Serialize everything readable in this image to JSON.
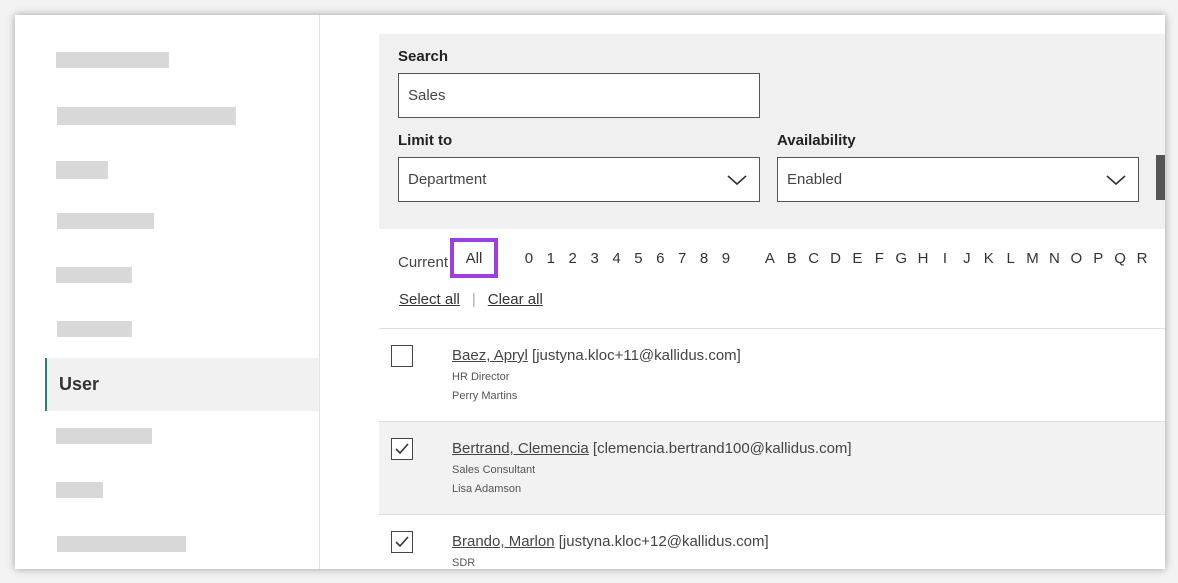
{
  "search": {
    "label": "Search",
    "value": "Sales"
  },
  "limit_to": {
    "label": "Limit to",
    "value": "Department"
  },
  "availability": {
    "label": "Availability",
    "value": "Enabled"
  },
  "alphabet": {
    "current_label": "Current",
    "all_label": "All",
    "chars": [
      "0",
      "1",
      "2",
      "3",
      "4",
      "5",
      "6",
      "7",
      "8",
      "9",
      " ",
      "A",
      "B",
      "C",
      "D",
      "E",
      "F",
      "G",
      "H",
      "I",
      "J",
      "K",
      "L",
      "M",
      "N",
      "O",
      "P",
      "Q",
      "R"
    ]
  },
  "selection": {
    "select_all": "Select all",
    "clear_all": "Clear all"
  },
  "sidebar": {
    "active_item": "User"
  },
  "users": [
    {
      "name": "Baez, Apryl",
      "email": "[justyna.kloc+11@kallidus.com]",
      "title": "HR Director",
      "manager": "Perry Martins",
      "checked": false
    },
    {
      "name": "Bertrand, Clemencia",
      "email": "[clemencia.bertrand100@kallidus.com]",
      "title": "Sales Consultant",
      "manager": "Lisa Adamson",
      "checked": true
    },
    {
      "name": "Brando, Marlon",
      "email": "[justyna.kloc+12@kallidus.com]",
      "title": "SDR",
      "manager": "",
      "checked": true
    }
  ],
  "colors": {
    "highlight": "#9b3fe0",
    "active_accent": "#2a7d74"
  }
}
